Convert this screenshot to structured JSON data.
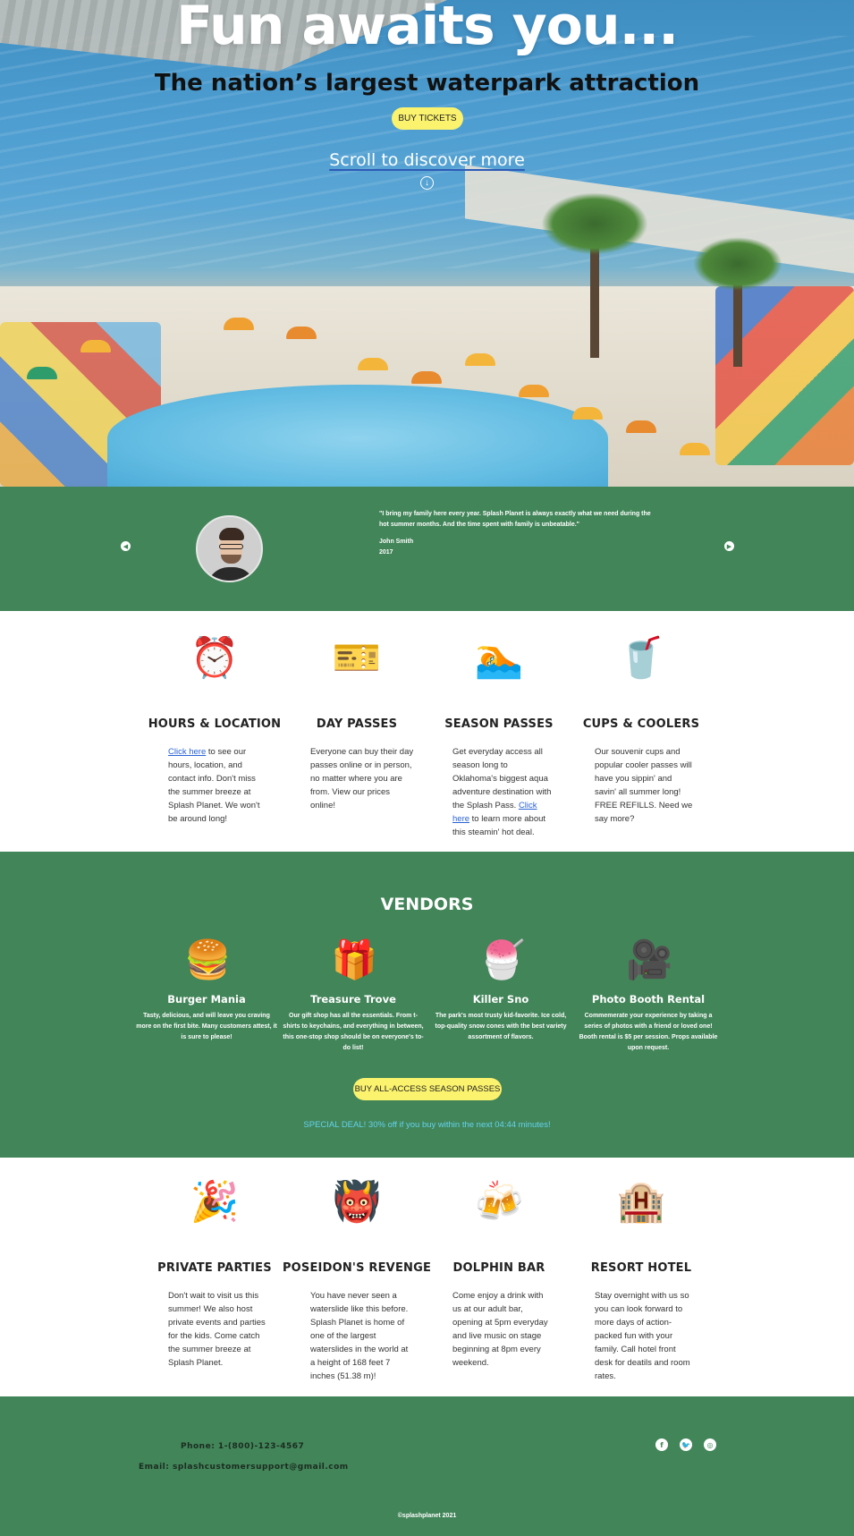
{
  "hero": {
    "title": "Fun awaits you...",
    "subtitle": "The nation’s largest waterpark attraction",
    "button_label": "BUY TICKETS",
    "scroll_text": "Scroll to discover more",
    "arrow_icon": "arrow-down-circle-icon"
  },
  "testimonial": {
    "quote": "\"I bring my family here every year. Splash Planet is always exactly what we need during the hot summer months. And the time spent with family is unbeatable.\"",
    "name": "John Smith",
    "year": "2017",
    "prev_icon": "chevron-left-icon",
    "next_icon": "chevron-right-icon"
  },
  "features_top": [
    {
      "icon": "alarm-clock-icon",
      "title": "HOURS & LOCATION",
      "link_text": "Click here",
      "text": " to see our hours, location, and contact info. Don't miss the summer breeze at Splash Planet. We won't be around long!"
    },
    {
      "icon": "tickets-icon",
      "title": "DAY PASSES",
      "text": "Everyone can buy their day passes online or in person, no matter where you are from. View our prices online!"
    },
    {
      "icon": "swimmer-icon",
      "title": "SEASON PASSES",
      "text_before": "Get everyday access all season long to Oklahoma's biggest aqua adventure destination with the Splash Pass. ",
      "link_text": "Click here",
      "text_after": " to learn more about this steamin' hot deal."
    },
    {
      "icon": "cup-icon",
      "title": "CUPS & COOLERS",
      "text": "Our souvenir cups and popular cooler passes will have you sippin' and savin' all summer long! FREE REFILLS. Need we say more?"
    }
  ],
  "vendors": {
    "title": "VENDORS",
    "items": [
      {
        "icon": "hamburger-icon",
        "name": "Burger Mania",
        "desc": "Tasty, delicious, and will leave you craving more on the first bite. Many customers attest, it is sure to please!"
      },
      {
        "icon": "gift-icon",
        "name": "Treasure Trove",
        "desc": "Our gift shop has all the essentials. From t-shirts to keychains, and everything in between, this one-stop shop should be on everyone's to-do list!"
      },
      {
        "icon": "snow-cone-icon",
        "name": "Killer Sno",
        "desc": "The park's most trusty kid-favorite. Ice cold, top-quality snow cones with the best variety assortment of flavors."
      },
      {
        "icon": "movie-camera-icon",
        "name": "Photo Booth Rental",
        "desc": "Commemerate your experience by taking a series of photos with a friend or loved one! Booth rental is $5 per session. Props available upon request."
      }
    ],
    "button_label": "BUY ALL-ACCESS SEASON PASSES",
    "deal_text": "SPECIAL DEAL! 30% off if you buy within the next 04:44 minutes!"
  },
  "features_bottom": [
    {
      "icon": "party-popper-icon",
      "title": "PRIVATE PARTIES",
      "text": "Don't wait to visit us this summer! We also host private events and parties for the kids. Come catch the summer breeze at Splash Planet."
    },
    {
      "icon": "devil-icon",
      "title": "POSEIDON'S REVENGE",
      "text": "You have never seen a waterslide like this before. Splash Planet is home of one of the largest waterslides in the world at a height of 168 feet 7 inches (51.38 m)!"
    },
    {
      "icon": "beer-mugs-icon",
      "title": "DOLPHIN BAR",
      "text": "Come enjoy a drink with us at our adult bar, opening at 5pm everyday and live music on stage beginning at 8pm every weekend."
    },
    {
      "icon": "hotel-icon",
      "title": "RESORT HOTEL",
      "text": "Stay overnight with us so you can look forward to more days of action-packed fun with your family. Call hotel front desk for deatils and room rates."
    }
  ],
  "footer": {
    "phone": "Phone: 1-(800)-123-4567",
    "email": "Email: splashcustomersupport@gmail.com",
    "social": [
      "facebook-icon",
      "twitter-icon",
      "instagram-icon"
    ],
    "copyright": "©splashplanet 2021"
  },
  "colors": {
    "green": "#428559",
    "yellow_button": "#fbf26e",
    "link_blue": "#2a63d4",
    "deal_cyan": "#64d3ec"
  }
}
